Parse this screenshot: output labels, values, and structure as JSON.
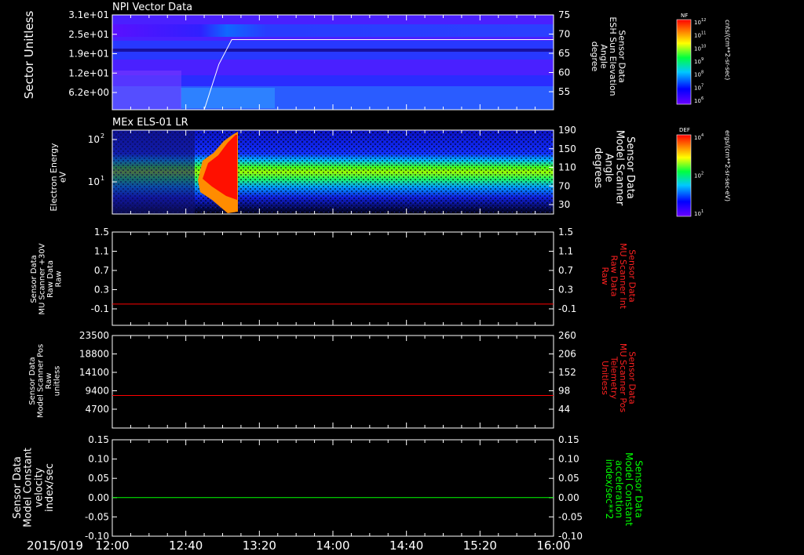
{
  "date": "2015/019",
  "time_ticks": [
    "12:00",
    "12:40",
    "13:20",
    "14:00",
    "14:40",
    "15:20",
    "16:00"
  ],
  "colorbars": [
    {
      "label": "NF",
      "unit": "cnts/(cm**2-sr-sec)",
      "ticks": [
        "10^12",
        "10^11",
        "10^10",
        "10^9",
        "10^8",
        "10^7",
        "10^6"
      ]
    },
    {
      "label": "DEF",
      "unit": "ergs/(cm**2-sr-sec-eV)",
      "ticks": [
        "10^4",
        "10^2",
        "10^1"
      ]
    }
  ],
  "chart_data": [
    {
      "type": "heatmap",
      "title": "NPI Vector Data",
      "ylabel": "Sector Unitless",
      "yticks": [
        "3.1e+01",
        "2.5e+01",
        "1.9e+01",
        "1.2e+01",
        "6.2e+00"
      ],
      "y2label": [
        "Sensor Data",
        "ESH Sun Elevation",
        "Angle",
        "degree"
      ],
      "y2ticks": [
        "75",
        "70",
        "65",
        "60",
        "55"
      ],
      "y2lim": [
        50,
        75
      ],
      "overlay_line": {
        "color": "#ffffff",
        "x": [
          "12:00",
          "12:50",
          "12:58",
          "13:05",
          "16:00"
        ],
        "y": [
          50,
          50,
          62,
          68.5,
          68.5
        ]
      }
    },
    {
      "type": "heatmap",
      "title": "MEx ELS-01 LR",
      "ylabel": [
        "Electron Energy",
        "eV"
      ],
      "yticks": [
        "10^2",
        "10^1"
      ],
      "y2label": [
        "Sensor Data",
        "Model Scanner",
        "Angle",
        "degrees"
      ],
      "y2ticks": [
        "190",
        "150",
        "110",
        "70",
        "30"
      ],
      "y2lim": [
        10,
        190
      ]
    },
    {
      "type": "line",
      "ylabel": [
        "Sensor Data",
        "MU Scanner +30V",
        "Raw Data",
        "Raw"
      ],
      "yticks": [
        "1.5",
        "1.1",
        "0.7",
        "0.3",
        "-0.1"
      ],
      "ylim": [
        -0.3,
        1.5
      ],
      "y2label": [
        "Sensor Data",
        "MU Scanner Int",
        "Raw Data",
        "Raw"
      ],
      "y2ticks": [
        "1.5",
        "1.1",
        "0.7",
        "0.3",
        "-0.1"
      ],
      "series": [
        {
          "color": "#ff0000",
          "x": [
            "12:00",
            "16:00"
          ],
          "y": [
            0.0,
            0.0
          ]
        }
      ]
    },
    {
      "type": "line",
      "ylabel": [
        "Sensor Data",
        "Model Scanner Pos",
        "Raw",
        "unitless"
      ],
      "yticks": [
        "23500",
        "18800",
        "14100",
        "9400",
        "4700"
      ],
      "ylim": [
        0,
        23500
      ],
      "y2label": [
        "Sensor Data",
        "MU Scanner Pos",
        "Telemetry",
        "Unitless"
      ],
      "y2ticks": [
        "260",
        "206",
        "152",
        "98",
        "44"
      ],
      "series": [
        {
          "color": "#ff0000",
          "x": [
            "12:00",
            "16:00"
          ],
          "y": [
            8200,
            8200
          ]
        }
      ]
    },
    {
      "type": "line",
      "ylabel": [
        "Sensor Data",
        "Model Constant",
        "velocity",
        "index/sec"
      ],
      "yticks": [
        "0.15",
        "0.10",
        "0.05",
        "0.00",
        "-0.05",
        "-0.10"
      ],
      "ylim": [
        -0.1,
        0.15
      ],
      "y2label": [
        "Sensor Data",
        "Model Constant",
        "acceleration",
        "index/sec**2"
      ],
      "y2ticks": [
        "0.15",
        "0.10",
        "0.05",
        "0.00",
        "-0.05",
        "-0.10"
      ],
      "series": [
        {
          "color": "#00ff00",
          "x": [
            "12:00",
            "16:00"
          ],
          "y": [
            0.0,
            0.0
          ]
        }
      ]
    }
  ]
}
